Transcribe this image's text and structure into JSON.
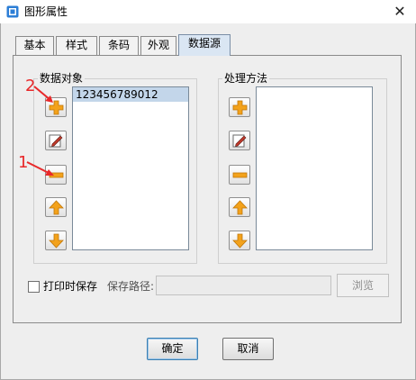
{
  "window": {
    "title": "图形属性"
  },
  "tabs": [
    {
      "label": "基本"
    },
    {
      "label": "样式"
    },
    {
      "label": "条码"
    },
    {
      "label": "外观"
    },
    {
      "label": "数据源"
    }
  ],
  "data_objects": {
    "title": "数据对象",
    "items": [
      "123456789012"
    ],
    "selected_index": 0
  },
  "processing": {
    "title": "处理方法",
    "items": []
  },
  "icon_buttons": [
    "add-icon",
    "edit-icon",
    "remove-icon",
    "move-up-icon",
    "move-down-icon"
  ],
  "save": {
    "checkbox_label": "打印时保存",
    "checked": false,
    "path_label": "保存路径:",
    "path_value": "",
    "browse_label": "浏览"
  },
  "footer": {
    "ok_label": "确定",
    "cancel_label": "取消"
  },
  "annotations": [
    {
      "number": "2"
    },
    {
      "number": "1"
    }
  ],
  "colors": {
    "annotation": "#e8282a",
    "icon_orange": "#f3a21b",
    "selection": "#c3d6ea",
    "active_tab": "#dae6f3"
  }
}
